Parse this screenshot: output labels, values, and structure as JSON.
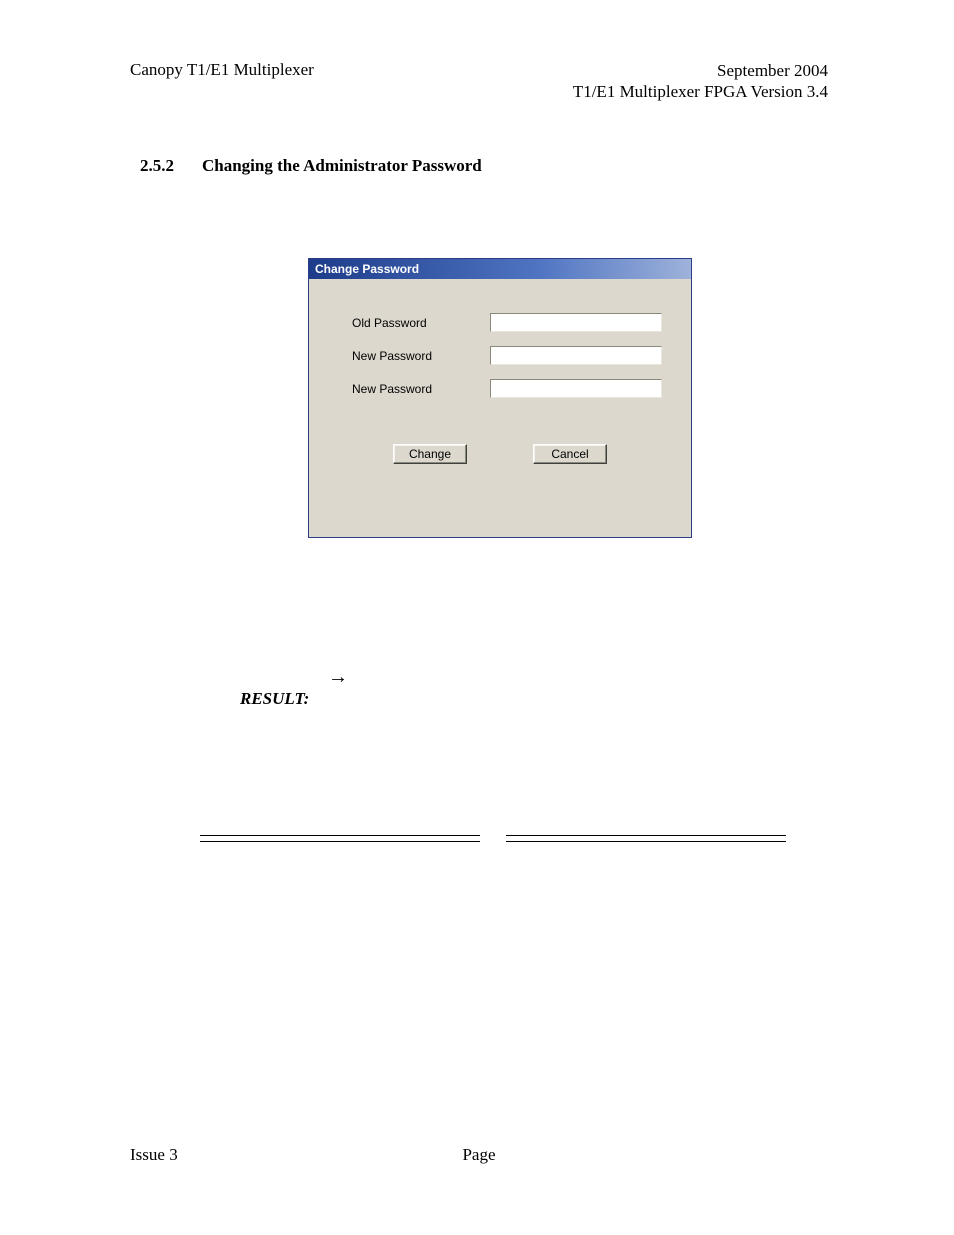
{
  "header": {
    "left": "Canopy T1/E1 Multiplexer",
    "right_line1": "September 2004",
    "right_line2": "T1/E1 Multiplexer FPGA Version 3.4"
  },
  "section": {
    "number": "2.5.2",
    "title": "Changing the Administrator Password"
  },
  "dialog": {
    "title": "Change Password",
    "field1_label": "Old Password",
    "field1_value": "",
    "field2_label": "New Password",
    "field2_value": "",
    "field3_label": "New Password",
    "field3_value": "",
    "button_change": "Change",
    "button_cancel": "Cancel"
  },
  "body": {
    "arrow": "→",
    "result_label": "RESULT:"
  },
  "footer": {
    "left": "Issue 3",
    "center": "Page"
  }
}
